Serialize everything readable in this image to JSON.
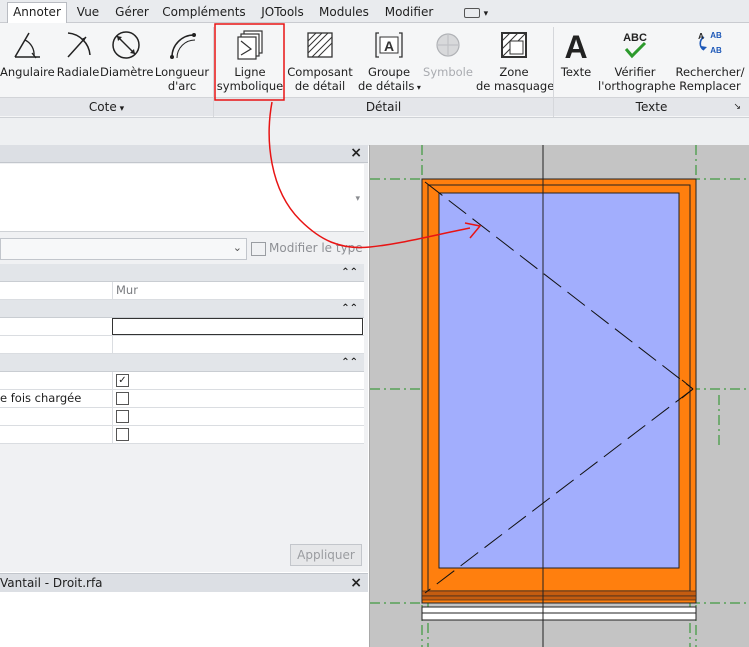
{
  "tabs": [
    "Annoter",
    "Vue",
    "Gérer",
    "Compléments",
    "JOTools",
    "Modules",
    "Modifier"
  ],
  "active_tab": "Annoter",
  "quick_access_label": "▾",
  "ribbon": {
    "buttons": {
      "angulaire": "Angulaire",
      "radiale": "Radiale",
      "diametre": "Diamètre",
      "longueur_arc_1": "Longueur",
      "longueur_arc_2": "d'arc",
      "ligne_symbolique_1": "Ligne",
      "ligne_symbolique_2": "symbolique",
      "composant_detail_1": "Composant",
      "composant_detail_2": "de détail",
      "groupe_details_1": "Groupe",
      "groupe_details_2": "de détails",
      "symbole": "Symbole",
      "zone_masquage_1": "Zone",
      "zone_masquage_2": "de masquage",
      "texte": "Texte",
      "verifier_1": "Vérifier",
      "verifier_2": "l'orthographe",
      "rechercher_1": "Rechercher/",
      "rechercher_2": "Remplacer"
    },
    "groups": {
      "cote": "Cote",
      "detail": "Détail",
      "texte": "Texte"
    }
  },
  "properties": {
    "close": "×",
    "type_selector_button": "Modifier le type",
    "host_value": "Mur",
    "loaded_label": "e fois chargée",
    "apply_button": "Appliquer",
    "checkbox_checked_mark": "✓"
  },
  "project_browser": {
    "title": "Vantail - Droit.rfa",
    "close": "×"
  },
  "colors": {
    "frame_orange": "#ff7f0e",
    "glass_blue": "#a2aefd",
    "annotation_red": "#e81414",
    "ref_plane_green": "#1f8f1f"
  }
}
